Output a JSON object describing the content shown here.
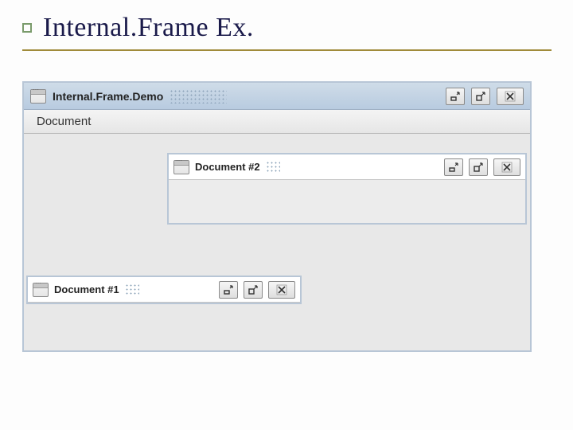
{
  "slide": {
    "title": "Internal.Frame Ex."
  },
  "main_window": {
    "title": "Internal.Frame.Demo",
    "menu": {
      "document": "Document"
    }
  },
  "internal_frames": {
    "doc1": {
      "title": "Document #1"
    },
    "doc2": {
      "title": "Document #2"
    }
  }
}
